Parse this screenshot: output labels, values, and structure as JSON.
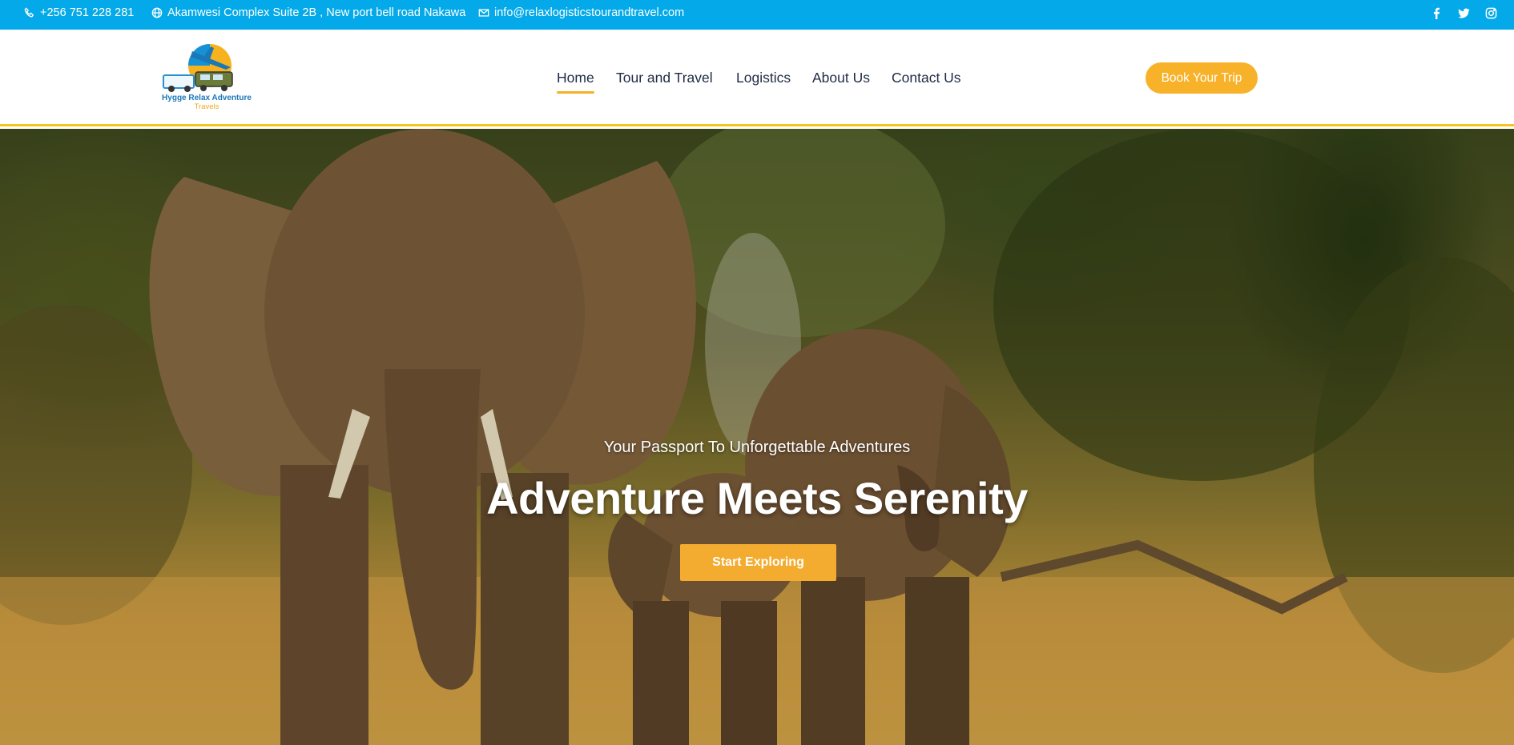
{
  "topbar": {
    "phone": "+256 751 228 281",
    "address": "Akamwesi Complex Suite 2B , New port bell road  Nakawa",
    "email": "info@relaxlogisticstourandtravel.com",
    "social": [
      {
        "icon": "facebook-icon"
      },
      {
        "icon": "twitter-icon"
      },
      {
        "icon": "instagram-icon"
      }
    ]
  },
  "header": {
    "logo": {
      "line1": "Hygge Relax Adventure",
      "line2": "Travels"
    },
    "nav": [
      {
        "label": "Home",
        "active": true
      },
      {
        "label": "Tour and Travel",
        "active": false
      },
      {
        "label": "Logistics",
        "active": false
      },
      {
        "label": "About Us",
        "active": false
      },
      {
        "label": "Contact Us",
        "active": false
      }
    ],
    "cta_label": "Book Your Trip"
  },
  "hero": {
    "tagline": "Your Passport To Unforgettable Adventures",
    "headline": "Adventure Meets Serenity",
    "cta_label": "Start Exploring"
  },
  "colors": {
    "topbar": "#03a9e9",
    "accent": "#f8b229",
    "header_border": "#f6c51c",
    "nav_text": "#1f2a44"
  }
}
